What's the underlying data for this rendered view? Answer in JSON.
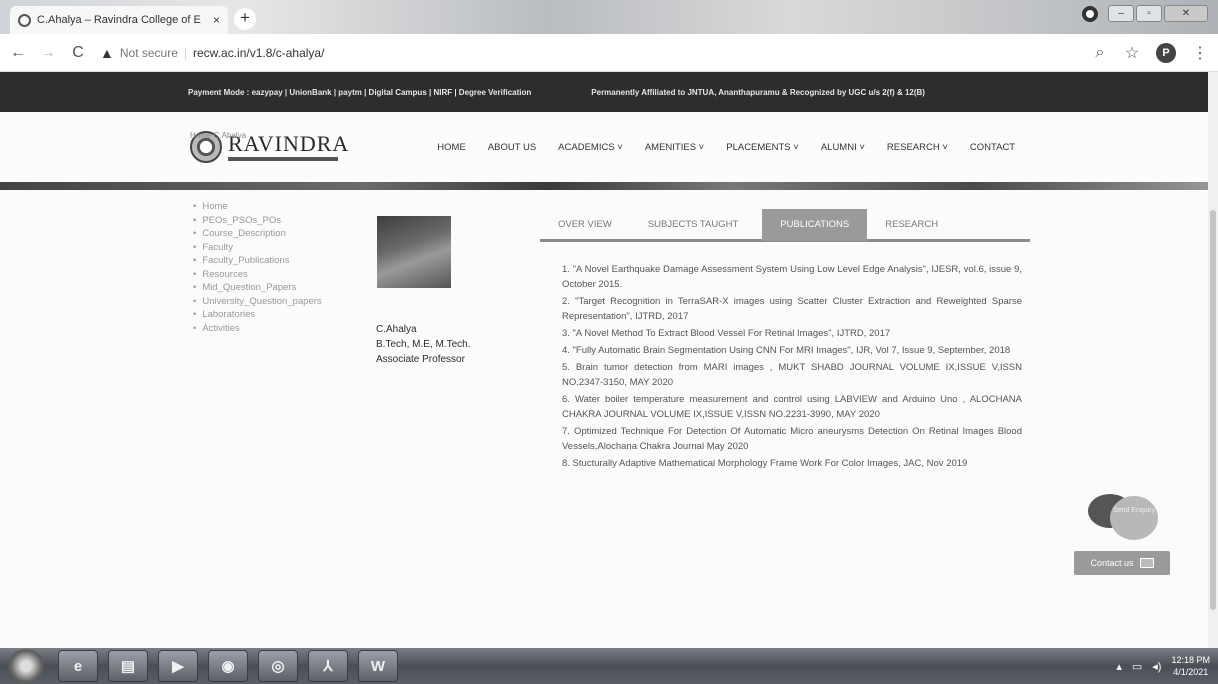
{
  "browser": {
    "tab_title": "C.Ahalya – Ravindra College of E",
    "tab_close": "×",
    "new_tab": "+",
    "not_secure": "Not secure",
    "url": "recw.ac.in/v1.8/c-ahalya/",
    "profile_initial": "P"
  },
  "topbar": {
    "left": "Payment Mode : eazypay  |  UnionBank  |  paytm  |  Digital Campus | NIRF | Degree Verification",
    "right": "Permanently Affiliated to JNTUA, Ananthapuramu & Recognized by UGC u/s 2(f) & 12(B)"
  },
  "header": {
    "logo_name": "RAVINDRA",
    "nav": [
      "HOME",
      "ABOUT US",
      "ACADEMICS ˅",
      "AMENITIES ˅",
      "PLACEMENTS ˅",
      "ALUMNI ˅",
      "RESEARCH ˅",
      "CONTACT"
    ]
  },
  "breadcrumb": "Home    C.Ahalya",
  "sidebar": {
    "items": [
      "Home",
      "PEOs_PSOs_POs",
      "Course_Description",
      "Faculty",
      "Faculty_Publications",
      "Resources",
      "Mid_Question_Papers",
      "University_Question_papers",
      "Laboratories",
      "Activities"
    ]
  },
  "profile": {
    "name": "C.Ahalya",
    "qualification": "B.Tech, M.E, M.Tech.",
    "designation": "Associate Professor"
  },
  "tabs": [
    "OVER VIEW",
    "SUBJECTS TAUGHT",
    "PUBLICATIONS",
    "RESEARCH"
  ],
  "publications": [
    "1. \"A Novel Earthquake Damage Assessment System Using Low Level Edge Analysis\", IJESR, vol.6, issue 9, October 2015.",
    "2. \"Target Recognition in TerraSAR-X images using Scatter Cluster Extraction and Reweighted Sparse Representation\", IJTRD, 2017",
    "3. \"A Novel Method To Extract Blood Vessel For Retinal Images\", IJTRD, 2017",
    "4. \"Fully Automatic Brain Segmentation Using CNN For MRI Images\", IJR, Vol 7, Issue 9, September, 2018",
    "5. Brain tumor detection from MARI images , MUKT SHABD JOURNAL VOLUME IX,ISSUE V,ISSN NO.2347-3150, MAY 2020",
    "6. Water boiler temperature measurement and control using LABVIEW and Arduino Uno , ALOCHANA CHAKRA JOURNAL VOLUME IX,ISSUE V,ISSN NO.2231-3990, MAY 2020",
    "7. Optimized Technique For Detection Of Automatic Micro aneurysms Detection On Retinal Images Blood Vessels,Alochana Chakra Journal May 2020",
    "8. Stucturally Adaptive Mathematical Morphology Frame Work For Color Images, JAC, Nov 2019"
  ],
  "chat": {
    "bubble_text": "Send Enquiry",
    "contact_label": "Contact us"
  },
  "taskbar": {
    "time": "12:18 PM",
    "date": "4/1/2021"
  }
}
